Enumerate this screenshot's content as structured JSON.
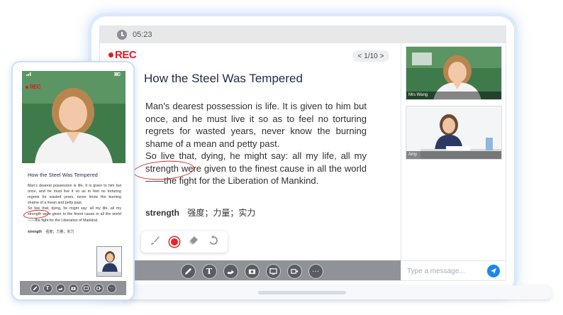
{
  "session": {
    "timer": "05:23",
    "rec_label": "REC",
    "page_prev": "<",
    "page_indicator": "1/10",
    "page_next": ">"
  },
  "document": {
    "title": "How the Steel Was Tempered",
    "paragraph_1": "Man's dearest possession is life. It is given to him but once, and he must live it so as to feel no torturing regrets for wasted years, never know the burning shame of a mean and petty past.",
    "paragraph_2": "So live that, dying, he might say: all my life, all my strength were given to the finest cause in all the world——the fight for the Liberation of Mankind.",
    "vocab_word": "strength",
    "vocab_meaning": "强度；力量；实力"
  },
  "pen_tools": [
    "brush-icon",
    "red-color-dot",
    "eraser-icon",
    "undo-icon"
  ],
  "toolbar": {
    "items": [
      "pencil-icon",
      "text-icon",
      "share-icon",
      "camera-icon",
      "screen-share-icon",
      "video-icon",
      "more-icon"
    ],
    "text_glyph": "T",
    "more_glyph": "···"
  },
  "participants": [
    {
      "name": "Mrs Wang"
    },
    {
      "name": "Amy"
    }
  ],
  "chat": {
    "placeholder": "Type a message..."
  },
  "colors": {
    "rec_red": "#e8161f",
    "toolbar_gray": "#8f9296",
    "send_blue": "#1f86e8",
    "frame_blue": "#dcebfb"
  }
}
